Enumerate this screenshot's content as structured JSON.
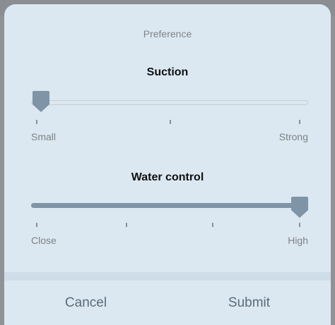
{
  "dialog": {
    "title": "Preference",
    "cancel_label": "Cancel",
    "submit_label": "Submit"
  },
  "suction": {
    "title": "Suction",
    "min_label": "Small",
    "max_label": "Strong",
    "levels": 4,
    "selected_index": 0
  },
  "water_control": {
    "title": "Water control",
    "min_label": "Close",
    "max_label": "High",
    "levels": 4,
    "selected_index": 3
  },
  "colors": {
    "sheet_background": "#dbe8f1",
    "slider_fill": "#7f94a6",
    "thumb": "#7f94a6"
  },
  "icons": {
    "slider_thumb": "pointer-thumb-icon"
  }
}
